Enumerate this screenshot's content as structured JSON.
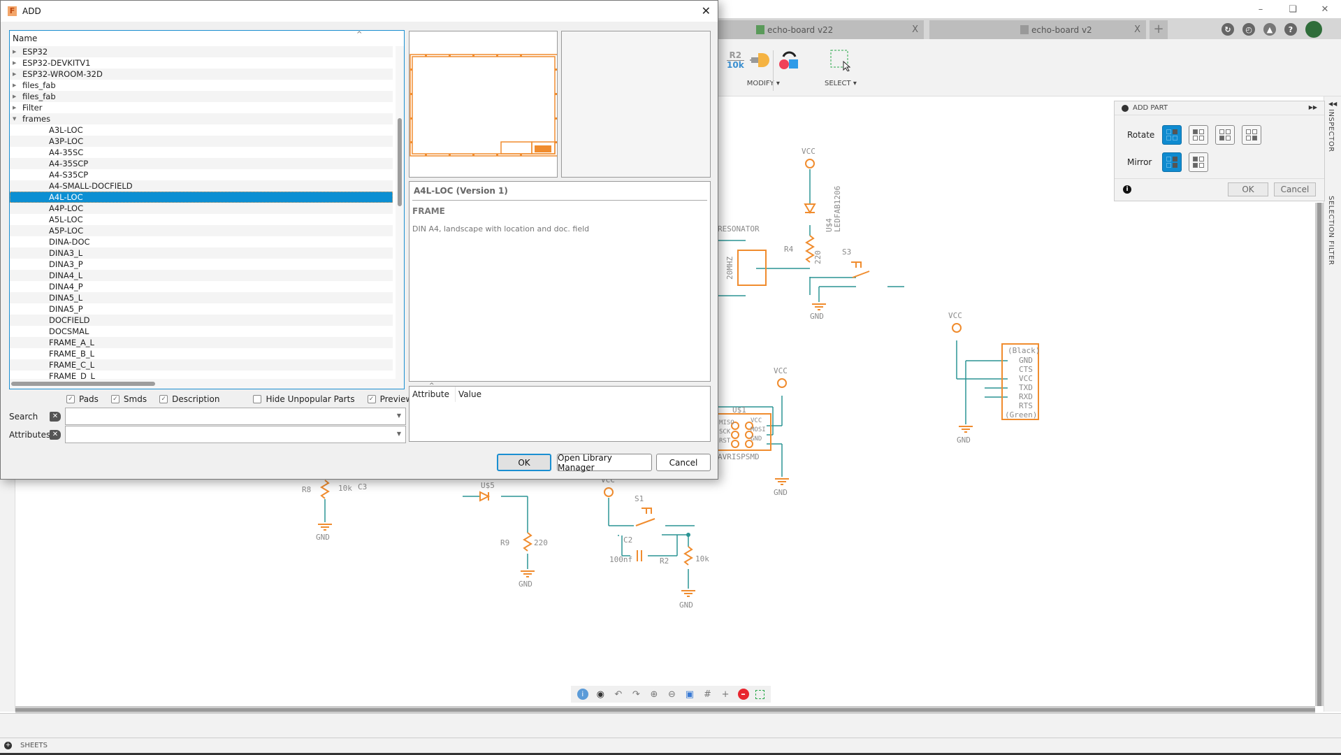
{
  "window": {
    "controls": [
      "minimize",
      "maximize",
      "close"
    ]
  },
  "tabs": [
    {
      "label": "echo-board v22",
      "icon": "schematic-icon",
      "close": "X"
    },
    {
      "label": "echo-board v2",
      "icon": "3d-box-icon",
      "close": "X"
    }
  ],
  "tab_add": "+",
  "header_icons": [
    "extensions-icon",
    "history-icon",
    "notifications-icon",
    "help-icon",
    "user-avatar"
  ],
  "ribbon": {
    "modify_label": "MODIFY ▾",
    "select_label": "SELECT ▾",
    "r2_top": "R2",
    "r2_bottom": "10k"
  },
  "add_part_panel": {
    "title": "ADD PART",
    "rotate_label": "Rotate",
    "mirror_label": "Mirror",
    "ok": "OK",
    "cancel": "Cancel",
    "rotate_selected_index": 0,
    "mirror_selected_index": 0
  },
  "right_sidebar": {
    "inspector": "INSPECTOR",
    "selection_filter": "SELECTION FILTER"
  },
  "sheets_label": "SHEETS",
  "nav_toolbar": [
    "info-icon",
    "eye-icon",
    "undo-icon",
    "redo-icon",
    "zoom-in-icon",
    "zoom-out-icon",
    "zoom-fit-icon",
    "grid-icon",
    "crosshair-icon",
    "stop-icon",
    "select-window-icon"
  ],
  "schematic_labels": {
    "vcc": "VCC",
    "gnd": "GND",
    "resonator": "RESONATOR",
    "freq": "20MHZ",
    "r4": "R4",
    "r4_val": "220",
    "u4": "U$4",
    "led_part": "LEDFAB1206",
    "s3": "S3",
    "u1": "U$1",
    "avrisp": "AVRISPSMD",
    "isp_pins": [
      "MISO",
      "SCK",
      "RST",
      "VCC",
      "MOSI",
      "GND"
    ],
    "ftdi_top": "(Black)",
    "ftdi_bottom": "(Green)",
    "ftdi_pins": [
      "GND",
      "CTS",
      "VCC",
      "TXD",
      "RXD",
      "RTS"
    ],
    "r8": "R8",
    "r8_val": "10k",
    "c3": "C3",
    "u5": "U$5",
    "r9": "R9",
    "r9_val": "220",
    "s1": "S1",
    "c2": "C2",
    "c2_val": "100nf",
    "r2": "R2",
    "r2_val": "10k"
  },
  "dialog": {
    "title": "ADD",
    "close": "✕",
    "tree_header": "Name",
    "tree_items": [
      {
        "label": "ESP32",
        "level": 0,
        "expanded": false
      },
      {
        "label": "ESP32-DEVKITV1",
        "level": 0,
        "expanded": false
      },
      {
        "label": "ESP32-WROOM-32D",
        "level": 0,
        "expanded": false
      },
      {
        "label": "files_fab",
        "level": 0,
        "expanded": false
      },
      {
        "label": "files_fab",
        "level": 0,
        "expanded": false
      },
      {
        "label": "Filter",
        "level": 0,
        "expanded": false
      },
      {
        "label": "frames",
        "level": 0,
        "expanded": true
      },
      {
        "label": "A3L-LOC",
        "level": 1
      },
      {
        "label": "A3P-LOC",
        "level": 1
      },
      {
        "label": "A4-35SC",
        "level": 1
      },
      {
        "label": "A4-35SCP",
        "level": 1
      },
      {
        "label": "A4-S35CP",
        "level": 1
      },
      {
        "label": "A4-SMALL-DOCFIELD",
        "level": 1
      },
      {
        "label": "A4L-LOC",
        "level": 1,
        "selected": true
      },
      {
        "label": "A4P-LOC",
        "level": 1
      },
      {
        "label": "A5L-LOC",
        "level": 1
      },
      {
        "label": "A5P-LOC",
        "level": 1
      },
      {
        "label": "DINA-DOC",
        "level": 1
      },
      {
        "label": "DINA3_L",
        "level": 1
      },
      {
        "label": "DINA3_P",
        "level": 1
      },
      {
        "label": "DINA4_L",
        "level": 1
      },
      {
        "label": "DINA4_P",
        "level": 1
      },
      {
        "label": "DINA5_L",
        "level": 1
      },
      {
        "label": "DINA5_P",
        "level": 1
      },
      {
        "label": "DOCFIELD",
        "level": 1
      },
      {
        "label": "DOCSMAL",
        "level": 1
      },
      {
        "label": "FRAME_A_L",
        "level": 1
      },
      {
        "label": "FRAME_B_L",
        "level": 1
      },
      {
        "label": "FRAME_C_L",
        "level": 1
      },
      {
        "label": "FRAME_D_L",
        "level": 1
      }
    ],
    "options": [
      {
        "label": "Pads",
        "checked": true
      },
      {
        "label": "Smds",
        "checked": true
      },
      {
        "label": "Description",
        "checked": true
      },
      {
        "label": "Hide Unpopular Parts",
        "checked": false
      },
      {
        "label": "Preview",
        "checked": true
      }
    ],
    "search_label": "Search",
    "search_value": "",
    "attributes_label": "Attributes",
    "attributes_value": "",
    "part_title": "A4L-LOC (Version 1)",
    "part_type": "FRAME",
    "part_description": "DIN A4, landscape with location and doc. field",
    "attr_col1": "Attribute",
    "attr_col2": "Value",
    "ok": "OK",
    "open_library_manager": "Open Library Manager",
    "cancel": "Cancel"
  },
  "colors": {
    "accent": "#0b8fd3",
    "schematic_part": "#f08c2e",
    "schematic_wire": "#2a9494",
    "schematic_text": "#8a8a8a"
  }
}
